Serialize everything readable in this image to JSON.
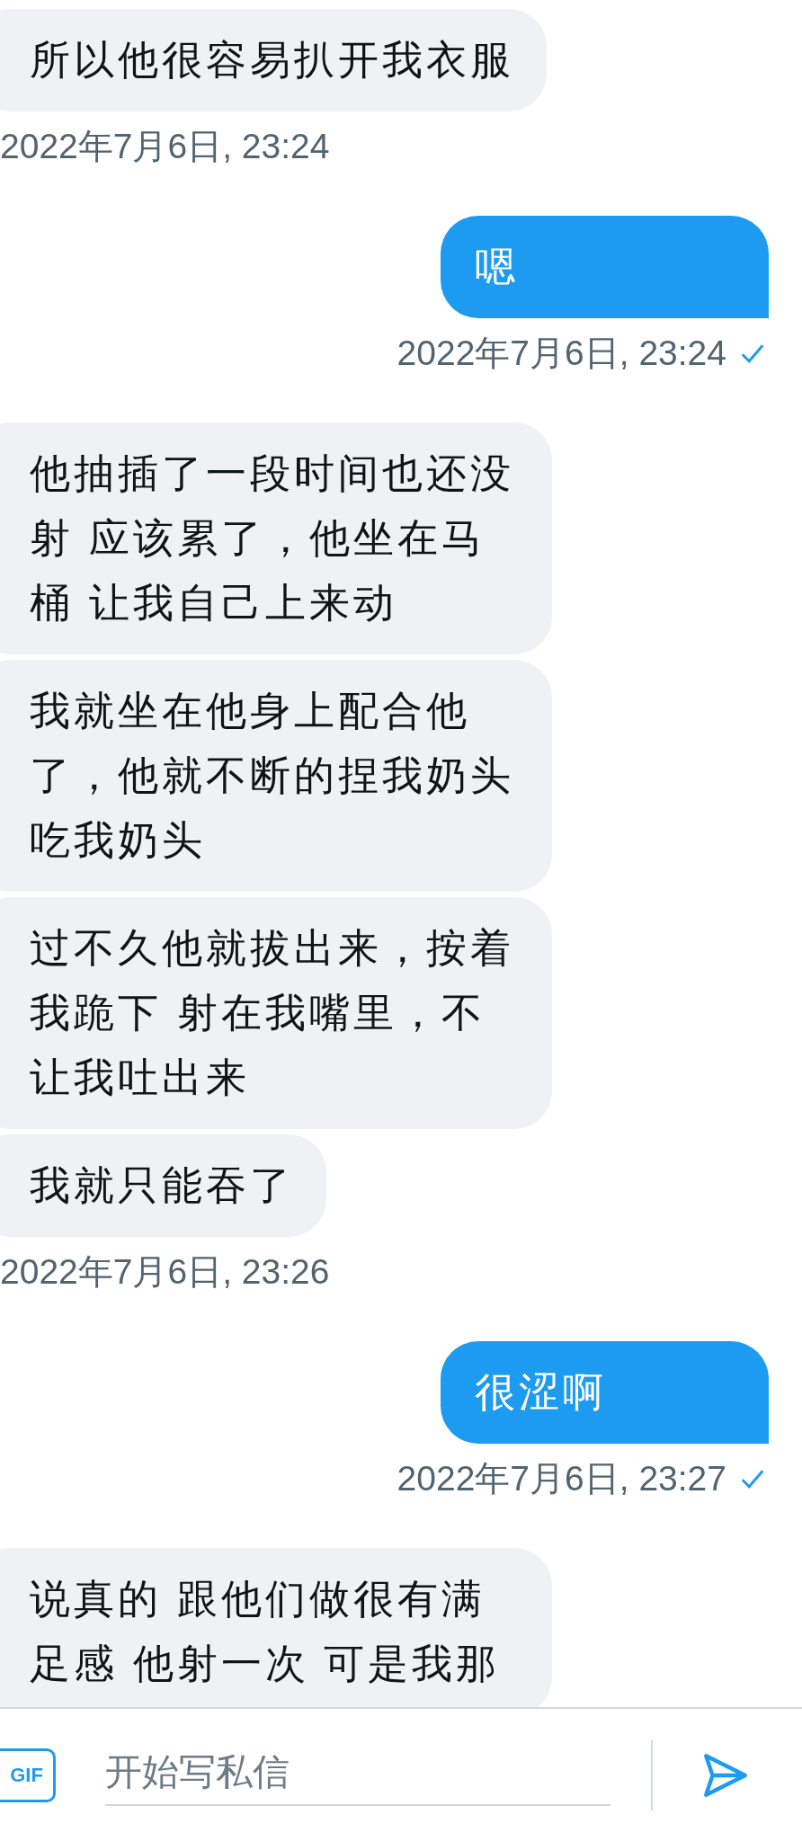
{
  "messages": [
    {
      "kind": "received",
      "text": "所以他很容易扒开我衣服"
    },
    {
      "kind": "time_received",
      "text": "2022年7月6日, 23:24"
    },
    {
      "kind": "sent",
      "text": "嗯"
    },
    {
      "kind": "time_sent",
      "text": "2022年7月6日, 23:24",
      "read": true
    },
    {
      "kind": "received",
      "text": "他抽插了一段时间也还没射 应该累了，他坐在马桶 让我自己上来动"
    },
    {
      "kind": "received",
      "text": "我就坐在他身上配合他了，他就不断的捏我奶头吃我奶头"
    },
    {
      "kind": "received",
      "text": "过不久他就拔出来，按着我跪下 射在我嘴里，不让我吐出来"
    },
    {
      "kind": "received",
      "text": "我就只能吞了"
    },
    {
      "kind": "time_received",
      "text": "2022年7月6日, 23:26"
    },
    {
      "kind": "sent",
      "text": "很涩啊"
    },
    {
      "kind": "time_sent",
      "text": "2022年7月6日, 23:27",
      "read": true
    },
    {
      "kind": "received",
      "text": "说真的 跟他们做很有满足感 他射一次 可是我那"
    }
  ],
  "composer": {
    "gif_label": "GIF",
    "placeholder": "开始写私信"
  }
}
